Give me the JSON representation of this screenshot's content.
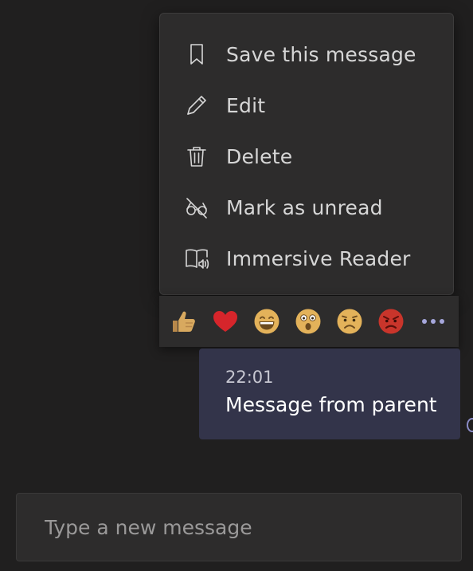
{
  "context_menu": {
    "items": [
      {
        "label": "Save this message",
        "icon": "bookmark-icon"
      },
      {
        "label": "Edit",
        "icon": "pencil-icon"
      },
      {
        "label": "Delete",
        "icon": "trash-icon"
      },
      {
        "label": "Mark as unread",
        "icon": "mark-unread-icon"
      },
      {
        "label": "Immersive Reader",
        "icon": "immersive-reader-icon"
      }
    ]
  },
  "reactions": {
    "items": [
      {
        "name": "like",
        "icon": "thumbs-up-icon"
      },
      {
        "name": "heart",
        "icon": "heart-icon"
      },
      {
        "name": "laugh",
        "icon": "laugh-icon"
      },
      {
        "name": "surprised",
        "icon": "surprised-icon"
      },
      {
        "name": "sad",
        "icon": "sad-icon"
      },
      {
        "name": "angry",
        "icon": "angry-icon"
      }
    ],
    "more_icon": "more-options-icon"
  },
  "message": {
    "timestamp": "22:01",
    "text": "Message from parent"
  },
  "compose": {
    "placeholder": "Type a new message"
  },
  "colors": {
    "background": "#201f1f",
    "menu_bg": "#2d2c2c",
    "bubble": "#33344a",
    "accent": "#a6a7dc"
  }
}
